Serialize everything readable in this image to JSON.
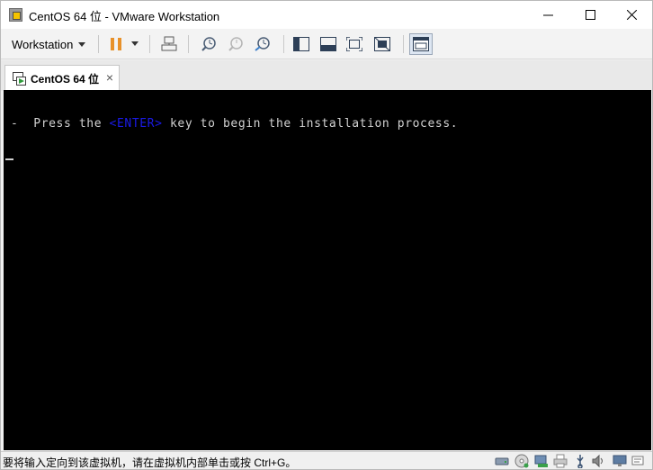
{
  "window": {
    "title": "CentOS 64 位 - VMware Workstation"
  },
  "toolbar": {
    "menu_label": "Workstation"
  },
  "tabs": [
    {
      "label": "CentOS 64 位",
      "close": "×"
    }
  ],
  "console": {
    "prefix": "-  Press the ",
    "key": "<ENTER>",
    "suffix": " key to begin the installation process."
  },
  "status": {
    "message": "要将输入定向到该虚拟机，请在虚拟机内部单击或按 Ctrl+G。"
  },
  "colors": {
    "console_bg": "#000000",
    "console_text": "#d2d2d2",
    "enter_key": "#1a1ae6",
    "pause_icon": "#e8912a"
  }
}
